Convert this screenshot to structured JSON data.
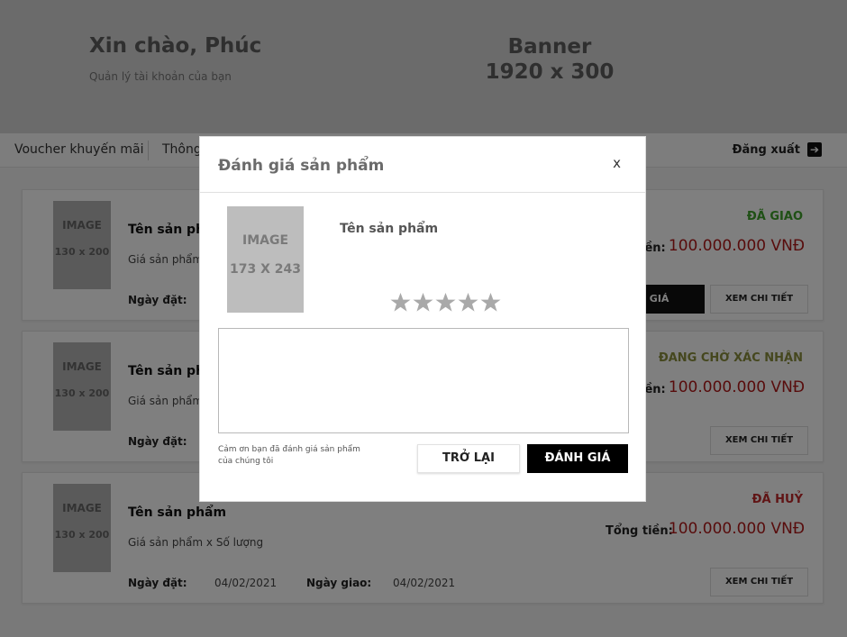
{
  "header": {
    "greeting": "Xin chào, Phúc",
    "subtitle": "Quản lý tài khoản của bạn",
    "banner_line1": "Banner",
    "banner_line2": "1920 x 300"
  },
  "nav": {
    "items": [
      "Voucher khuyến mãi",
      "Thông"
    ],
    "logout": "Đăng xuất"
  },
  "orders": [
    {
      "image_line1": "IMAGE",
      "image_line2": "130 x 200",
      "name": "Tên sản phẩm",
      "price_text": "Giá sản phẩm",
      "order_date_label": "Ngày đặt:",
      "status": "ĐÃ GIAO",
      "total_label": "iền:",
      "total": "100.000.000 VNĐ",
      "primary_button": "NH GIÁ",
      "detail_button": "XEM CHI TIẾT"
    },
    {
      "image_line1": "IMAGE",
      "image_line2": "130 x 200",
      "name": "Tên sản phẩ",
      "price_text": "Giá sản phẩm",
      "order_date_label": "Ngày đặt:",
      "status": "ĐANG CHỜ XÁC NHẬN",
      "total_label": "iền:",
      "total": "100.000.000 VNĐ",
      "detail_button": "XEM CHI TIẾT"
    },
    {
      "image_line1": "IMAGE",
      "image_line2": "130 x 200",
      "name": "Tên sản phẩm",
      "price_text": "Giá sản phẩm  x   Số lượng",
      "order_date_label": "Ngày đặt:",
      "order_date": "04/02/2021",
      "delivery_date_label": "Ngày giao:",
      "delivery_date": "04/02/2021",
      "status": "ĐÃ HUỶ",
      "total_label": "Tổng tiền:",
      "total": "100.000.000 VNĐ",
      "detail_button": "XEM CHI TIẾT"
    }
  ],
  "status_colors": {
    "delivered": "#3fa12a",
    "pending": "#8a8f3c",
    "cancelled": "#c0282a"
  },
  "modal": {
    "title": "Đánh giá sản phẩm",
    "close": "x",
    "image_line1": "IMAGE",
    "image_line2": "173 X 243",
    "product_name": "Tên sản phẩm",
    "rating": 0,
    "max_rating": 5,
    "review_text": "",
    "thanks": "Cảm ơn bạn đã đánh giá sản phẩm của chúng tôi",
    "back_button": "TRỞ LẠI",
    "submit_button": "ĐÁNH GIÁ"
  }
}
